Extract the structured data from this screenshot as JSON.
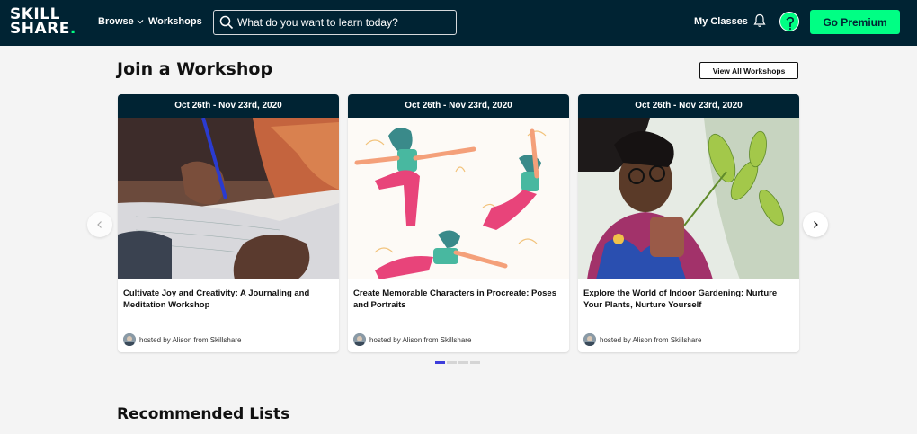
{
  "header": {
    "logo_line1": "SKILL",
    "logo_line2": "SHARE",
    "logo_dot": ".",
    "nav_browse": "Browse",
    "nav_workshops": "Workshops",
    "search_placeholder": "What do you want to learn today?",
    "my_classes": "My Classes",
    "premium_label": "Go Premium"
  },
  "workshops": {
    "title": "Join a Workshop",
    "view_all": "View All Workshops",
    "cards": [
      {
        "date": "Oct 26th - Nov 23rd, 2020",
        "title": "Cultivate Joy and Creativity: A Journaling and Meditation Workshop",
        "host": "hosted by Alison from Skillshare"
      },
      {
        "date": "Oct 26th - Nov 23rd, 2020",
        "title": "Create Memorable Characters in Procreate: Poses and Portraits",
        "host": "hosted by Alison from Skillshare"
      },
      {
        "date": "Oct 26th - Nov 23rd, 2020",
        "title": "Explore the World of Indoor Gardening: Nurture Your Plants, Nurture Yourself",
        "host": "hosted by Alison from Skillshare"
      }
    ],
    "carousel_pages": 4,
    "carousel_active": 1
  },
  "recommended": {
    "title": "Recommended Lists"
  },
  "colors": {
    "header_bg": "#002333",
    "accent": "#00ff84",
    "carousel_active": "#3d3ddb"
  },
  "icons": [
    "search-icon",
    "chevron-down-icon",
    "bell-icon",
    "chevron-left-icon",
    "chevron-right-icon"
  ]
}
